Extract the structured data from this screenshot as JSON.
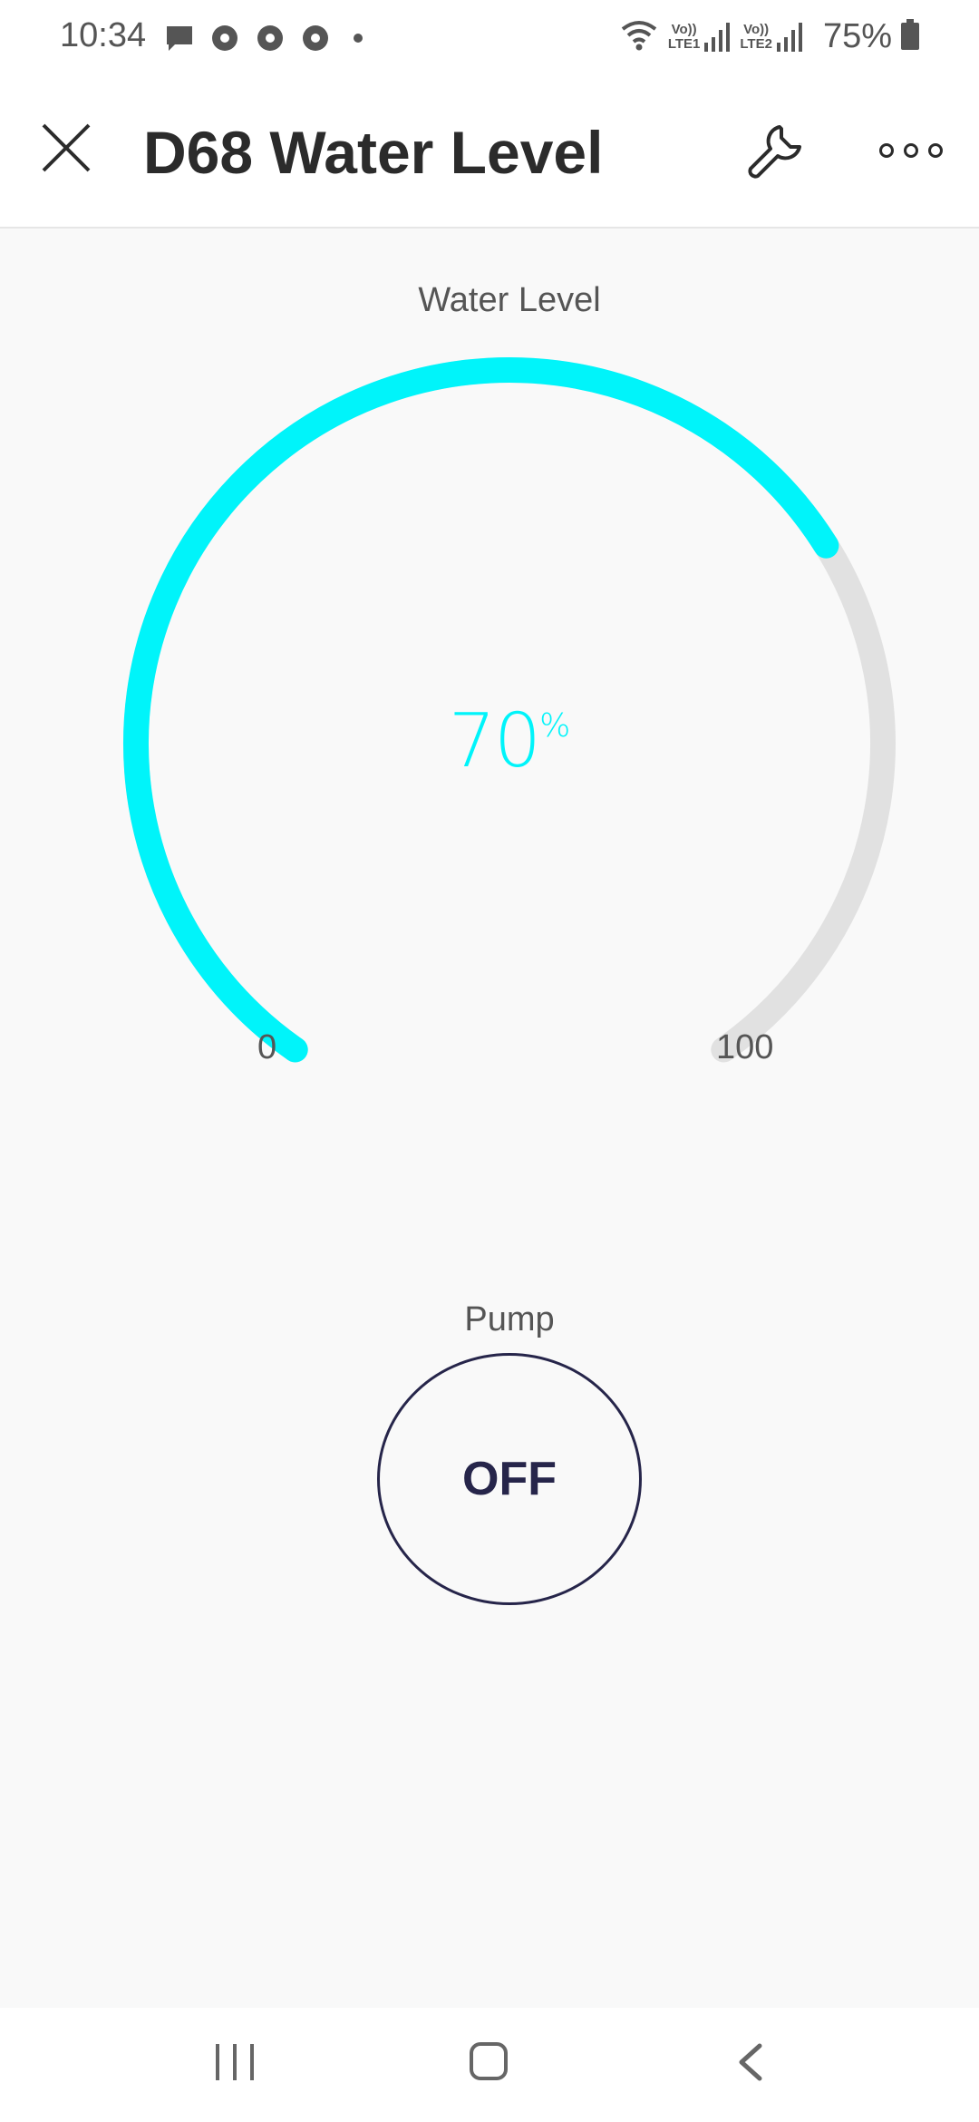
{
  "status_bar": {
    "time": "10:34",
    "notification_icons": [
      "message-icon",
      "app-notification-icon",
      "app-notification-icon",
      "app-notification-icon"
    ],
    "sim1_label_top": "Vo))",
    "sim1_label_bottom": "LTE1",
    "sim2_label_top": "Vo))",
    "sim2_label_bottom": "LTE2",
    "battery": "75%"
  },
  "app_bar": {
    "title": "D68 Water Level",
    "icons": [
      "close-icon",
      "wrench-icon",
      "more-icon"
    ]
  },
  "gauge": {
    "title": "Water Level",
    "value": "70",
    "unit": "%",
    "min_label": "0",
    "max_label": "100",
    "fraction": 0.7,
    "active_color": "#00f4fa",
    "track_color": "#e1e1e1"
  },
  "pump": {
    "label": "Pump",
    "state": "OFF",
    "color": "#26254a"
  },
  "nav_bar": {
    "icons": [
      "recents-icon",
      "home-icon",
      "back-icon"
    ]
  }
}
